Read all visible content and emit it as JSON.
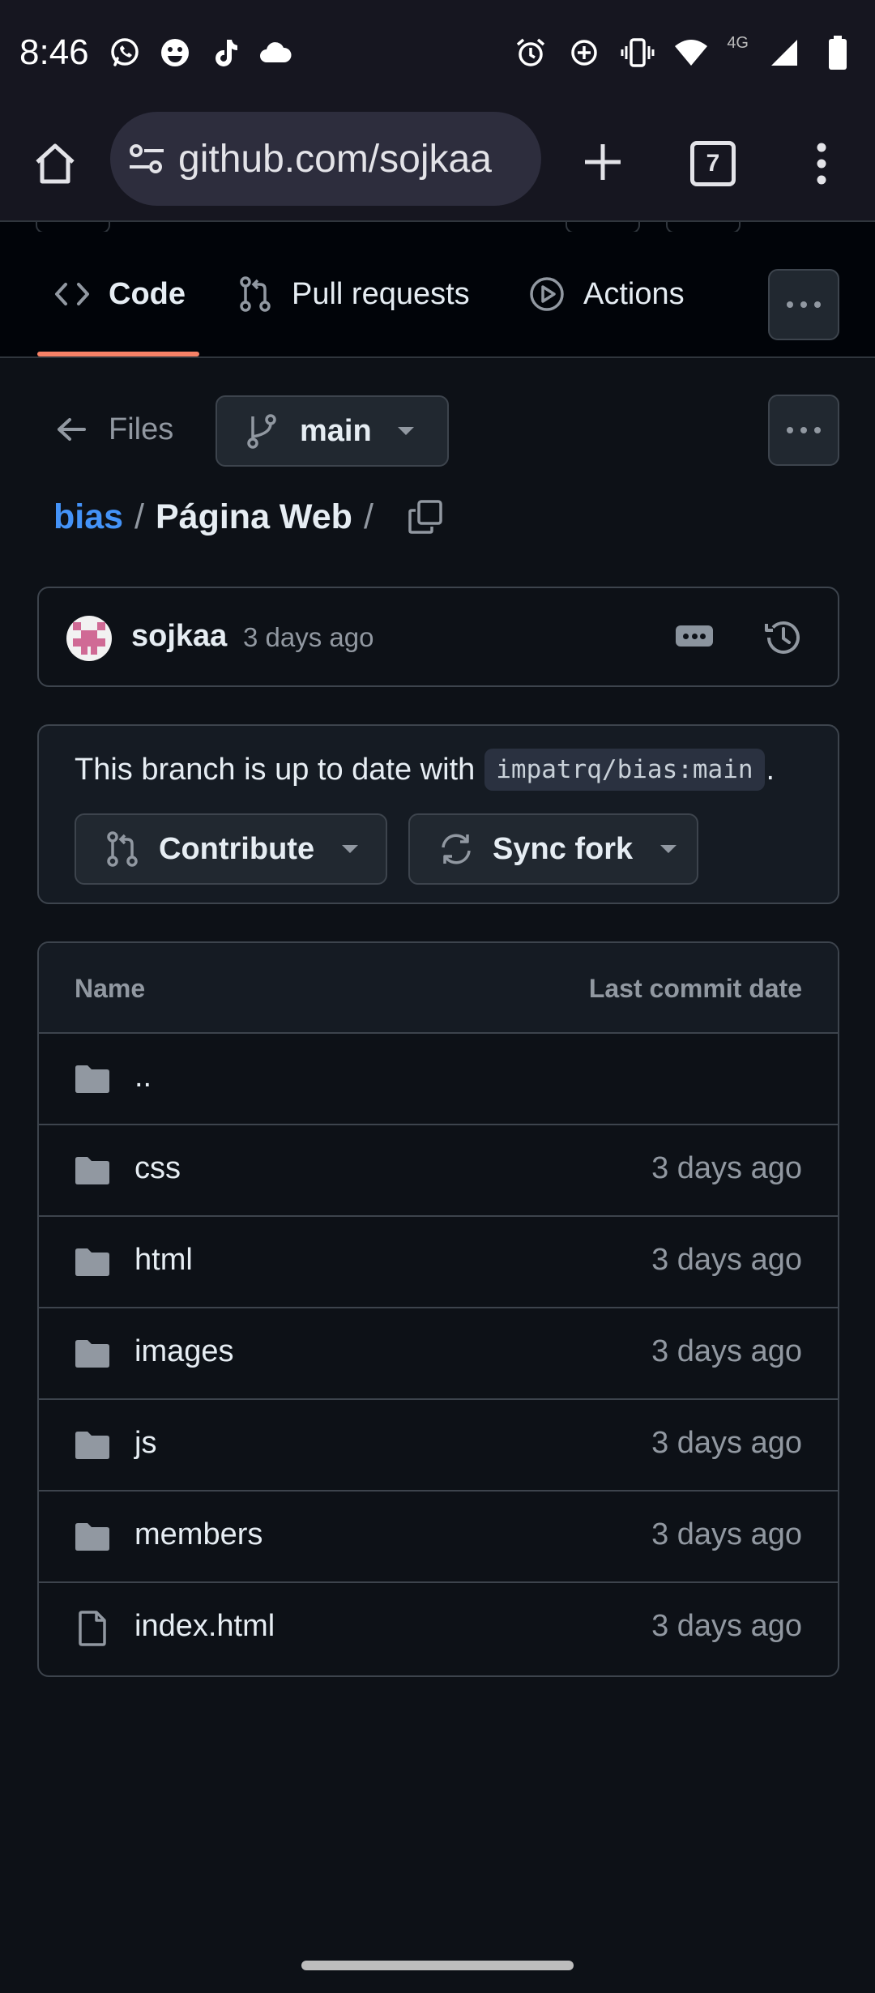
{
  "status_bar": {
    "time": "8:46",
    "left_icons": [
      "whatsapp-icon",
      "smiley-icon",
      "tiktok-icon",
      "cloud-icon"
    ],
    "right_icons": [
      "alarm-icon",
      "data-saver-icon",
      "vibrate-icon",
      "wifi-icon",
      "signal-icon",
      "battery-icon"
    ],
    "network": "4G"
  },
  "browser": {
    "url": "github.com/sojkaa",
    "tab_count": "7"
  },
  "repo_nav": {
    "tabs": [
      {
        "label": "Code",
        "icon": "code-icon",
        "active": true
      },
      {
        "label": "Pull requests",
        "icon": "git-pull-request-icon"
      },
      {
        "label": "Actions",
        "icon": "play-icon"
      }
    ]
  },
  "file_nav": {
    "back_label": "Files",
    "branch": "main"
  },
  "breadcrumb": {
    "repo": "bias",
    "separator": "/",
    "current": "Página Web",
    "trailing_sep": "/"
  },
  "commit": {
    "author": "sojkaa",
    "time": "3 days ago"
  },
  "branch_status": {
    "text": "This branch is up to date with",
    "ref": "impatrq/bias:main",
    "end": ".",
    "contribute_label": "Contribute",
    "sync_label": "Sync fork"
  },
  "files": {
    "header_name": "Name",
    "header_date": "Last commit date",
    "rows": [
      {
        "name": "..",
        "date": "",
        "type": "folder"
      },
      {
        "name": "css",
        "date": "3 days ago",
        "type": "folder"
      },
      {
        "name": "html",
        "date": "3 days ago",
        "type": "folder"
      },
      {
        "name": "images",
        "date": "3 days ago",
        "type": "folder"
      },
      {
        "name": "js",
        "date": "3 days ago",
        "type": "folder"
      },
      {
        "name": "members",
        "date": "3 days ago",
        "type": "folder"
      },
      {
        "name": "index.html",
        "date": "3 days ago",
        "type": "file"
      }
    ]
  },
  "colors": {
    "background": "#0d1117",
    "link": "#4493f8",
    "active_tab_underline": "#f78166",
    "border": "#3d444d",
    "muted_text": "#9198a1"
  }
}
